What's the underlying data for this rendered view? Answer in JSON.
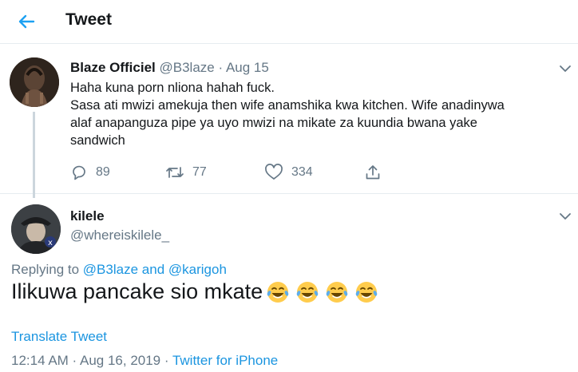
{
  "header": {
    "title": "Tweet",
    "back_icon": "arrow-left-icon"
  },
  "colors": {
    "accent": "#1da1f2",
    "link": "#1b95e0",
    "muted": "#657786",
    "text": "#14171a",
    "divider": "#e6ecf0"
  },
  "parent_tweet": {
    "name": "Blaze Officiel",
    "handle": "@B3laze",
    "separator": "·",
    "date": "Aug 15",
    "text_lines": [
      "Haha kuna porn nliona hahah fuck.",
      "Sasa ati mwizi amekuja then wife anamshika kwa kitchen. Wife anadinywa",
      "alaf anapanguza pipe ya uyo mwizi na mikate za kuundia bwana yake",
      "sandwich"
    ],
    "actions": {
      "replies": "89",
      "retweets": "77",
      "likes": "334"
    }
  },
  "main_tweet": {
    "name": "kilele",
    "handle": "@whereiskilele_",
    "replying_prefix": "Replying to",
    "replying_user1": "@B3laze",
    "replying_and": "and",
    "replying_user2": "@karigoh",
    "text": "Ilikuwa pancake sio mkate",
    "emoji_icons": [
      "face-with-tears-of-joy-icon",
      "face-with-tears-of-joy-icon",
      "face-with-tears-of-joy-icon",
      "face-with-tears-of-joy-icon"
    ],
    "translate_label": "Translate Tweet",
    "timestamp": "12:14 AM · Aug 16, 2019 ·",
    "source": "Twitter for iPhone"
  }
}
